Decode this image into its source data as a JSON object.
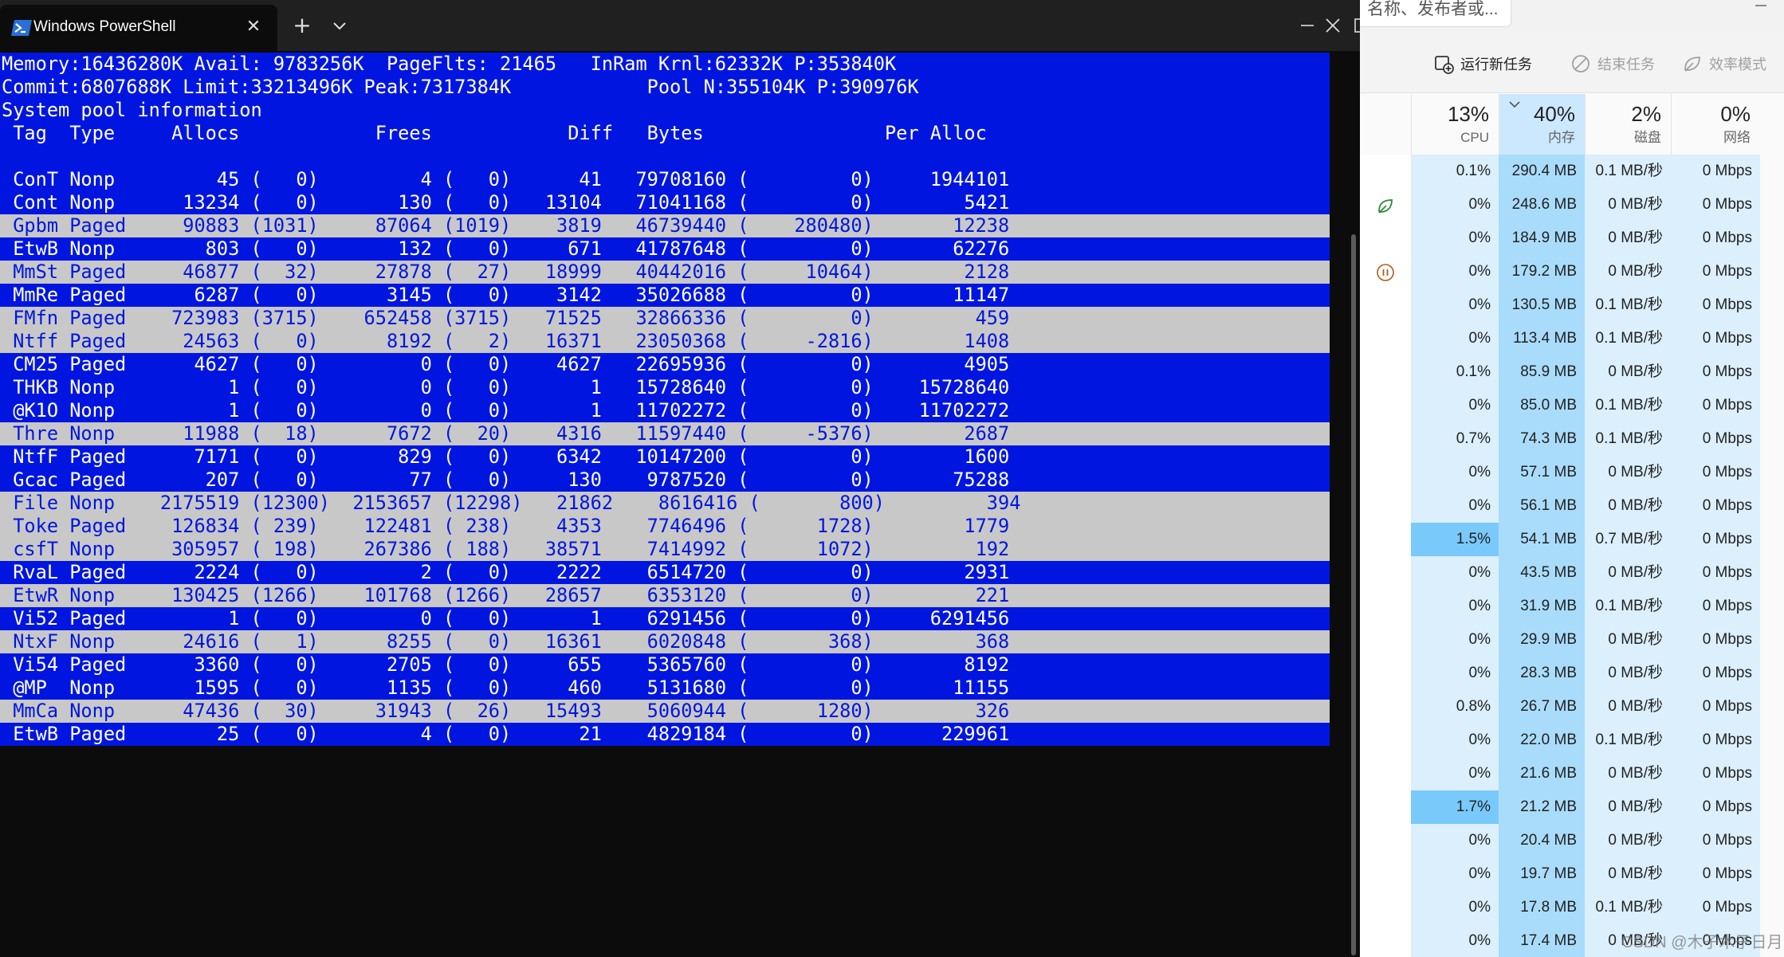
{
  "powershell": {
    "tab_title": "Windows PowerShell",
    "close_tab_glyph": "✕",
    "new_tab_glyph": "+",
    "minimize_glyph": "—",
    "maximize_glyph": "☐",
    "close_window_glyph": "✕",
    "colors": {
      "blue": "#0016e0",
      "grey": "#c8c8c8",
      "white": "#ffffff",
      "bg": "#0c0c0c"
    },
    "console": {
      "header_lines": [
        "Memory:16436280K Avail: 9783256K  PageFlts: 21465   InRam Krnl:62332K P:353840K",
        "Commit:6807688K Limit:33213496K Peak:7317384K            Pool N:355104K P:390976K",
        "System pool information",
        " Tag  Type     Allocs            Frees            Diff   Bytes                Per Alloc",
        ""
      ],
      "rows": [
        {
          "style": "blue",
          "text": " ConT Nonp         45 (   0)         4 (   0)      41   79708160 (         0)     1944101"
        },
        {
          "style": "blue",
          "text": " Cont Nonp      13234 (   0)       130 (   0)   13104   71041168 (         0)        5421"
        },
        {
          "style": "grey",
          "text": " Gpbm Paged     90883 (1031)     87064 (1019)    3819   46739440 (    280480)       12238"
        },
        {
          "style": "blue",
          "text": " EtwB Nonp        803 (   0)       132 (   0)     671   41787648 (         0)       62276"
        },
        {
          "style": "grey",
          "text": " MmSt Paged     46877 (  32)     27878 (  27)   18999   40442016 (     10464)        2128"
        },
        {
          "style": "blue",
          "text": " MmRe Paged      6287 (   0)      3145 (   0)    3142   35026688 (         0)       11147"
        },
        {
          "style": "grey",
          "text": " FMfn Paged    723983 (3715)    652458 (3715)   71525   32866336 (         0)         459"
        },
        {
          "style": "grey",
          "text": " Ntff Paged     24563 (   0)      8192 (   2)   16371   23050368 (     -2816)        1408"
        },
        {
          "style": "blue",
          "text": " CM25 Paged      4627 (   0)         0 (   0)    4627   22695936 (         0)        4905"
        },
        {
          "style": "blue",
          "text": " THKB Nonp          1 (   0)         0 (   0)       1   15728640 (         0)    15728640"
        },
        {
          "style": "blue",
          "text": " @K1O Nonp          1 (   0)         0 (   0)       1   11702272 (         0)    11702272"
        },
        {
          "style": "grey",
          "text": " Thre Nonp      11988 (  18)      7672 (  20)    4316   11597440 (     -5376)        2687"
        },
        {
          "style": "blue",
          "text": " NtfF Paged      7171 (   0)       829 (   0)    6342   10147200 (         0)        1600"
        },
        {
          "style": "blue",
          "text": " Gcac Paged       207 (   0)        77 (   0)     130    9787520 (         0)       75288"
        },
        {
          "style": "grey",
          "text": " File Nonp    2175519 (12300)  2153657 (12298)   21862    8616416 (       800)         394"
        },
        {
          "style": "grey",
          "text": " Toke Paged    126834 ( 239)    122481 ( 238)    4353    7746496 (      1728)        1779"
        },
        {
          "style": "grey",
          "text": " csfT Nonp     305957 ( 198)    267386 ( 188)   38571    7414992 (      1072)         192"
        },
        {
          "style": "blue",
          "text": " RvaL Paged      2224 (   0)         2 (   0)    2222    6514720 (         0)        2931"
        },
        {
          "style": "grey",
          "text": " EtwR Nonp     130425 (1266)    101768 (1266)   28657    6353120 (         0)         221"
        },
        {
          "style": "blue",
          "text": " Vi52 Paged         1 (   0)         0 (   0)       1    6291456 (         0)     6291456"
        },
        {
          "style": "grey",
          "text": " NtxF Nonp      24616 (   1)      8255 (   0)   16361    6020848 (       368)         368"
        },
        {
          "style": "blue",
          "text": " Vi54 Paged      3360 (   0)      2705 (   0)     655    5365760 (         0)        8192"
        },
        {
          "style": "blue",
          "text": " @MP  Nonp       1595 (   0)      1135 (   0)     460    5131680 (         0)       11155"
        },
        {
          "style": "grey",
          "text": " MmCa Nonp      47436 (  30)     31943 (  26)   15493    5060944 (      1280)         326"
        },
        {
          "style": "blue",
          "text": " EtwB Paged        25 (   0)         4 (   0)      21    4829184 (         0)      229961"
        }
      ]
    }
  },
  "taskmanager": {
    "search_placeholder": "名称、发布者或...",
    "toolbar": {
      "run_new_task": "运行新任务",
      "end_task": "结束任务",
      "efficiency_mode": "效率模式"
    },
    "columns": [
      {
        "percent": "13%",
        "label": "CPU"
      },
      {
        "percent": "40%",
        "label": "内存"
      },
      {
        "percent": "2%",
        "label": "磁盘"
      },
      {
        "percent": "0%",
        "label": "网络"
      }
    ],
    "rows": [
      {
        "status": "",
        "cpu": "0.1%",
        "mem": "290.4 MB",
        "disk": "0.1 MB/秒",
        "net": "0 Mbps",
        "cpu_hot": false
      },
      {
        "status": "leaf",
        "cpu": "0%",
        "mem": "248.6 MB",
        "disk": "0 MB/秒",
        "net": "0 Mbps",
        "cpu_hot": false
      },
      {
        "status": "",
        "cpu": "0%",
        "mem": "184.9 MB",
        "disk": "0 MB/秒",
        "net": "0 Mbps",
        "cpu_hot": false
      },
      {
        "status": "pause",
        "cpu": "0%",
        "mem": "179.2 MB",
        "disk": "0 MB/秒",
        "net": "0 Mbps",
        "cpu_hot": false
      },
      {
        "status": "",
        "cpu": "0%",
        "mem": "130.5 MB",
        "disk": "0.1 MB/秒",
        "net": "0 Mbps",
        "cpu_hot": false
      },
      {
        "status": "",
        "cpu": "0%",
        "mem": "113.4 MB",
        "disk": "0.1 MB/秒",
        "net": "0 Mbps",
        "cpu_hot": false
      },
      {
        "status": "",
        "cpu": "0.1%",
        "mem": "85.9 MB",
        "disk": "0 MB/秒",
        "net": "0 Mbps",
        "cpu_hot": false
      },
      {
        "status": "",
        "cpu": "0%",
        "mem": "85.0 MB",
        "disk": "0.1 MB/秒",
        "net": "0 Mbps",
        "cpu_hot": false
      },
      {
        "status": "",
        "cpu": "0.7%",
        "mem": "74.3 MB",
        "disk": "0.1 MB/秒",
        "net": "0 Mbps",
        "cpu_hot": false
      },
      {
        "status": "",
        "cpu": "0%",
        "mem": "57.1 MB",
        "disk": "0 MB/秒",
        "net": "0 Mbps",
        "cpu_hot": false
      },
      {
        "status": "",
        "cpu": "0%",
        "mem": "56.1 MB",
        "disk": "0 MB/秒",
        "net": "0 Mbps",
        "cpu_hot": false
      },
      {
        "status": "",
        "cpu": "1.5%",
        "mem": "54.1 MB",
        "disk": "0.7 MB/秒",
        "net": "0 Mbps",
        "cpu_hot": true
      },
      {
        "status": "",
        "cpu": "0%",
        "mem": "43.5 MB",
        "disk": "0 MB/秒",
        "net": "0 Mbps",
        "cpu_hot": false
      },
      {
        "status": "",
        "cpu": "0%",
        "mem": "31.9 MB",
        "disk": "0.1 MB/秒",
        "net": "0 Mbps",
        "cpu_hot": false
      },
      {
        "status": "",
        "cpu": "0%",
        "mem": "29.9 MB",
        "disk": "0 MB/秒",
        "net": "0 Mbps",
        "cpu_hot": false
      },
      {
        "status": "",
        "cpu": "0%",
        "mem": "28.3 MB",
        "disk": "0 MB/秒",
        "net": "0 Mbps",
        "cpu_hot": false
      },
      {
        "status": "",
        "cpu": "0.8%",
        "mem": "26.7 MB",
        "disk": "0 MB/秒",
        "net": "0 Mbps",
        "cpu_hot": false
      },
      {
        "status": "",
        "cpu": "0%",
        "mem": "22.0 MB",
        "disk": "0.1 MB/秒",
        "net": "0 Mbps",
        "cpu_hot": false
      },
      {
        "status": "",
        "cpu": "0%",
        "mem": "21.6 MB",
        "disk": "0 MB/秒",
        "net": "0 Mbps",
        "cpu_hot": false
      },
      {
        "status": "",
        "cpu": "1.7%",
        "mem": "21.2 MB",
        "disk": "0 MB/秒",
        "net": "0 Mbps",
        "cpu_hot": true
      },
      {
        "status": "",
        "cpu": "0%",
        "mem": "20.4 MB",
        "disk": "0 MB/秒",
        "net": "0 Mbps",
        "cpu_hot": false
      },
      {
        "status": "",
        "cpu": "0%",
        "mem": "19.7 MB",
        "disk": "0 MB/秒",
        "net": "0 Mbps",
        "cpu_hot": false
      },
      {
        "status": "",
        "cpu": "0%",
        "mem": "17.8 MB",
        "disk": "0.1 MB/秒",
        "net": "0 Mbps",
        "cpu_hot": false
      },
      {
        "status": "",
        "cpu": "0%",
        "mem": "17.4 MB",
        "disk": "0 MB/秒",
        "net": "0 Mbps",
        "cpu_hot": false
      }
    ],
    "colors": {
      "cell": "#dbeffd",
      "mem": "#a9dcfb",
      "cpu_hot": "#79c9fb"
    }
  },
  "watermark": "CSDN @木子木子日月"
}
